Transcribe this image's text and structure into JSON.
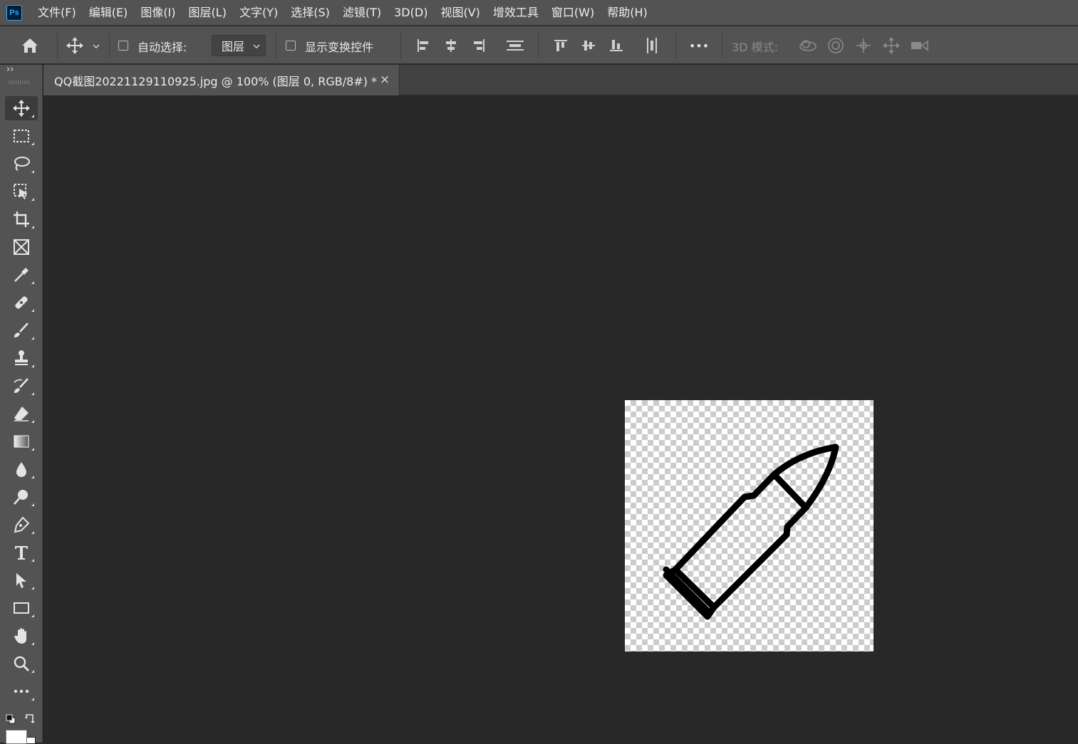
{
  "app": {
    "logo": "Ps"
  },
  "menu": {
    "items": [
      "文件(F)",
      "编辑(E)",
      "图像(I)",
      "图层(L)",
      "文字(Y)",
      "选择(S)",
      "滤镜(T)",
      "3D(D)",
      "视图(V)",
      "增效工具",
      "窗口(W)",
      "帮助(H)"
    ]
  },
  "options": {
    "auto_select_label": "自动选择:",
    "auto_select_value": "图层",
    "show_transform_label": "显示变换控件",
    "more": "•••",
    "mode_3d_label": "3D 模式:"
  },
  "panel_toggle": "››",
  "document": {
    "tab_title": "QQ截图20221129110925.jpg @ 100% (图层 0, RGB/8#) *",
    "close_glyph": "×"
  },
  "tools": [
    "move-tool",
    "marquee-tool",
    "lasso-tool",
    "object-select-tool",
    "crop-tool",
    "frame-tool",
    "eyedropper-tool",
    "healing-brush-tool",
    "brush-tool",
    "clone-stamp-tool",
    "history-brush-tool",
    "eraser-tool",
    "gradient-tool",
    "blur-tool",
    "dodge-tool",
    "pen-tool",
    "type-tool",
    "path-select-tool",
    "rectangle-tool",
    "hand-tool",
    "zoom-tool",
    "edit-toolbar"
  ],
  "colors": {
    "ui_panel": "#535353",
    "workspace": "#282828",
    "accent": "#31a8ff"
  }
}
